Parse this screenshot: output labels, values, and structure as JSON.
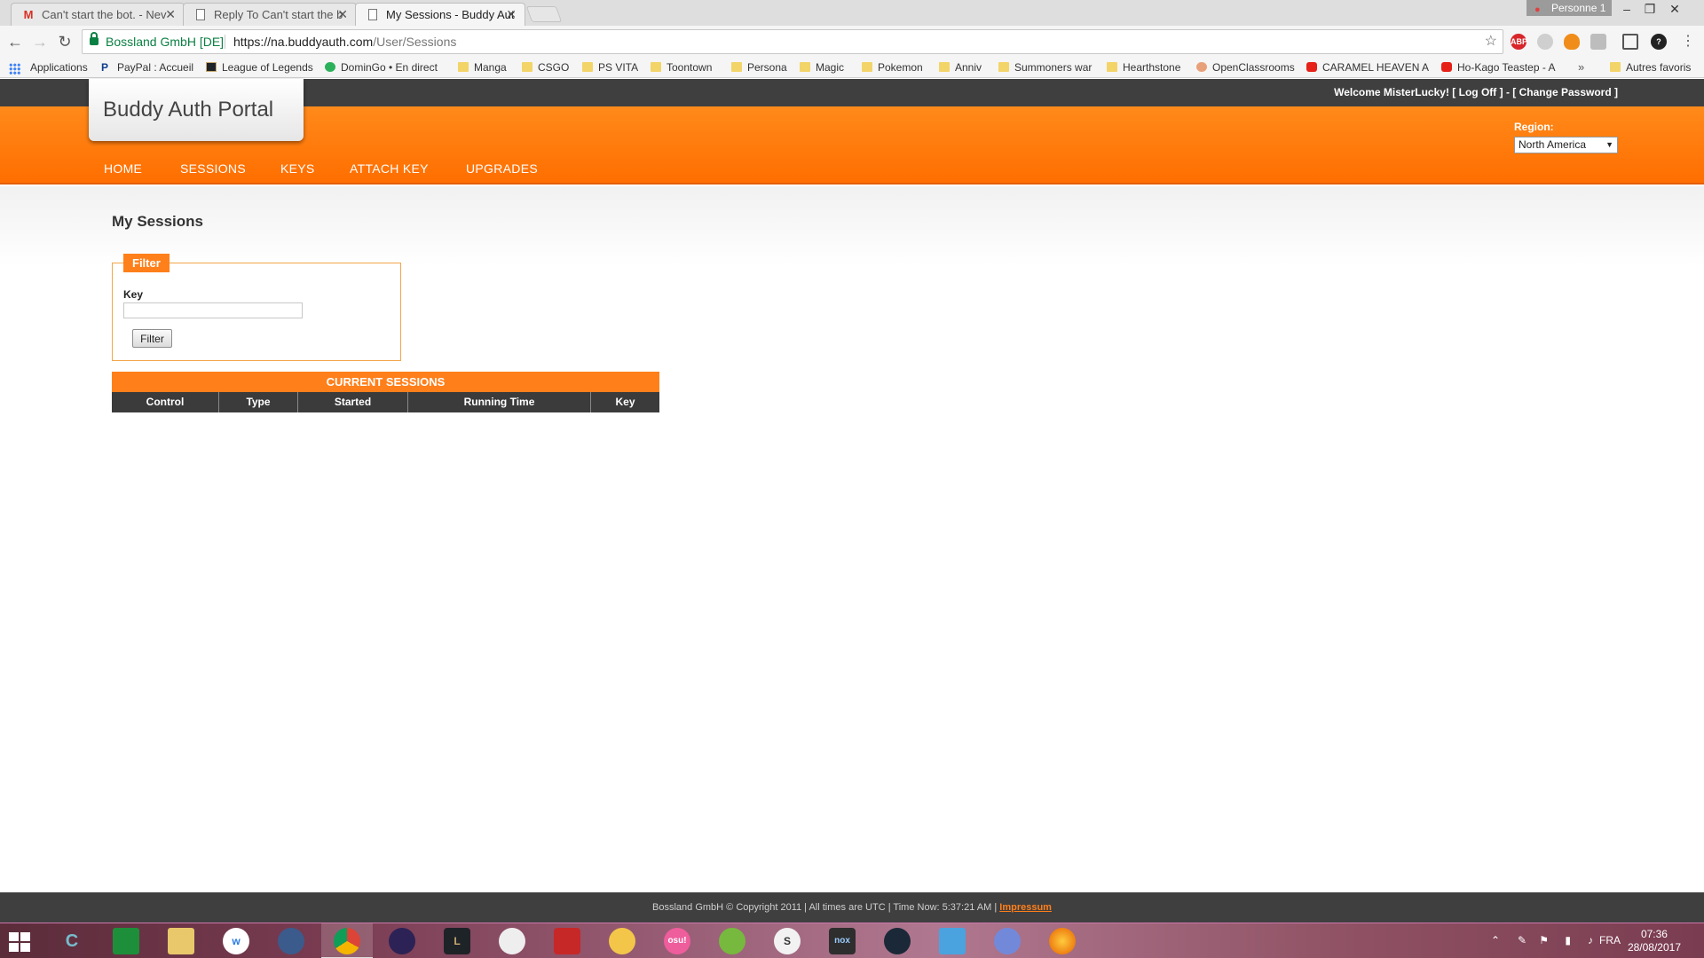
{
  "browser": {
    "tabs": [
      {
        "title": "Can't start the bot. - Nev",
        "icon": "gmail-icon"
      },
      {
        "title": "Reply To Can't start the b",
        "icon": "document-icon"
      },
      {
        "title": "My Sessions - Buddy Aut",
        "icon": "document-icon",
        "active": true
      }
    ],
    "profile_name": "Personne 1",
    "address": {
      "secure_org": "Bossland GmbH [DE]",
      "url_host": "https://na.buddyauth.com",
      "url_path": "/User/Sessions"
    },
    "bookmarks": [
      {
        "label": "Applications",
        "icon": "apps-grid-icon"
      },
      {
        "label": "PayPal : Accueil",
        "icon": "paypal-icon"
      },
      {
        "label": "League of Legends",
        "icon": "lol-icon"
      },
      {
        "label": "DominGo • En direct",
        "icon": "domingo-icon"
      },
      {
        "label": "Manga",
        "icon": "folder-icon"
      },
      {
        "label": "CSGO",
        "icon": "folder-icon"
      },
      {
        "label": "PS VITA",
        "icon": "folder-icon"
      },
      {
        "label": "Toontown",
        "icon": "folder-icon"
      },
      {
        "label": "Persona",
        "icon": "folder-icon"
      },
      {
        "label": "Magic",
        "icon": "folder-icon"
      },
      {
        "label": "Pokemon",
        "icon": "folder-icon"
      },
      {
        "label": "Anniv",
        "icon": "folder-icon"
      },
      {
        "label": "Summoners war",
        "icon": "folder-icon"
      },
      {
        "label": "Hearthstone",
        "icon": "folder-icon"
      },
      {
        "label": "OpenClassrooms",
        "icon": "openclassrooms-icon"
      },
      {
        "label": "CARAMEL HEAVEN A",
        "icon": "youtube-icon"
      },
      {
        "label": "Ho-Kago Teastep - A",
        "icon": "youtube-icon"
      }
    ],
    "bookmarks_more": "»",
    "bookmarks_other": "Autres favoris"
  },
  "site": {
    "logo": "Buddy Auth Portal",
    "welcome_prefix": "Welcome MisterLucky! [",
    "logoff": "Log Off",
    "middle": "] - [",
    "change_password": "Change Password",
    "welcome_suffix": "]",
    "nav": [
      "HOME",
      "SESSIONS",
      "KEYS",
      "ATTACH KEY",
      "UPGRADES"
    ],
    "region_label": "Region:",
    "region_value": "North America"
  },
  "page": {
    "title": "My Sessions",
    "filter": {
      "legend": "Filter",
      "key_label": "Key",
      "key_value": "",
      "button": "Filter"
    },
    "sessions": {
      "header": "CURRENT SESSIONS",
      "columns": [
        "Control",
        "Type",
        "Started",
        "Running Time",
        "Key"
      ],
      "rows": []
    },
    "footer_text": "Bossland GmbH © Copyright 2011 | All times are UTC | Time Now: 5:37:21 AM |",
    "footer_link": "Impressum"
  },
  "taskbar": {
    "language": "FRA",
    "time": "07:36",
    "date": "28/08/2017"
  },
  "colors": {
    "accent_orange": "#ff7f1a",
    "dark_bar": "#3f3f3f"
  }
}
